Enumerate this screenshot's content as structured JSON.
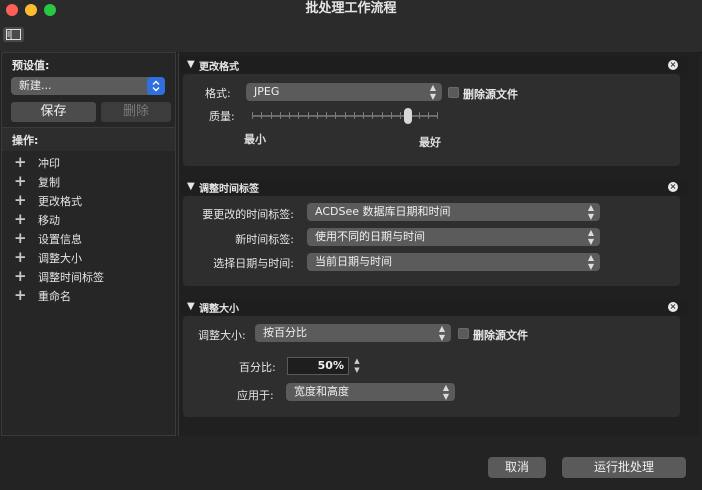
{
  "window": {
    "title": "批处理工作流程"
  },
  "sidebar": {
    "preset_label": "预设值:",
    "preset_value": "新建...",
    "save_label": "保存",
    "delete_label": "删除",
    "ops_label": "操作:",
    "operations": [
      {
        "label": "冲印"
      },
      {
        "label": "复制"
      },
      {
        "label": "更改格式"
      },
      {
        "label": "移动"
      },
      {
        "label": "设置信息"
      },
      {
        "label": "调整大小"
      },
      {
        "label": "调整时间标签"
      },
      {
        "label": "重命名"
      }
    ]
  },
  "change_format": {
    "title": "更改格式",
    "format_label": "格式:",
    "format_value": "JPEG",
    "delete_source_label": "删除源文件",
    "quality_label": "质量:",
    "quality_min_label": "最小",
    "quality_max_label": "最好",
    "quality_value": 0.84
  },
  "adjust_time": {
    "title": "调整时间标签",
    "change_label": "要更改的时间标签:",
    "change_value": "ACDSee 数据库日期和时间",
    "new_label": "新时间标签:",
    "new_value": "使用不同的日期与时间",
    "select_label": "选择日期与时间:",
    "select_value": "当前日期与时间"
  },
  "resize": {
    "title": "调整大小",
    "resize_label": "调整大小:",
    "resize_value": "按百分比",
    "delete_source_label": "删除源文件",
    "percent_label": "百分比:",
    "percent_value": "50%",
    "apply_label": "应用于:",
    "apply_value": "宽度和高度"
  },
  "footer": {
    "cancel_label": "取消",
    "run_label": "运行批处理"
  }
}
